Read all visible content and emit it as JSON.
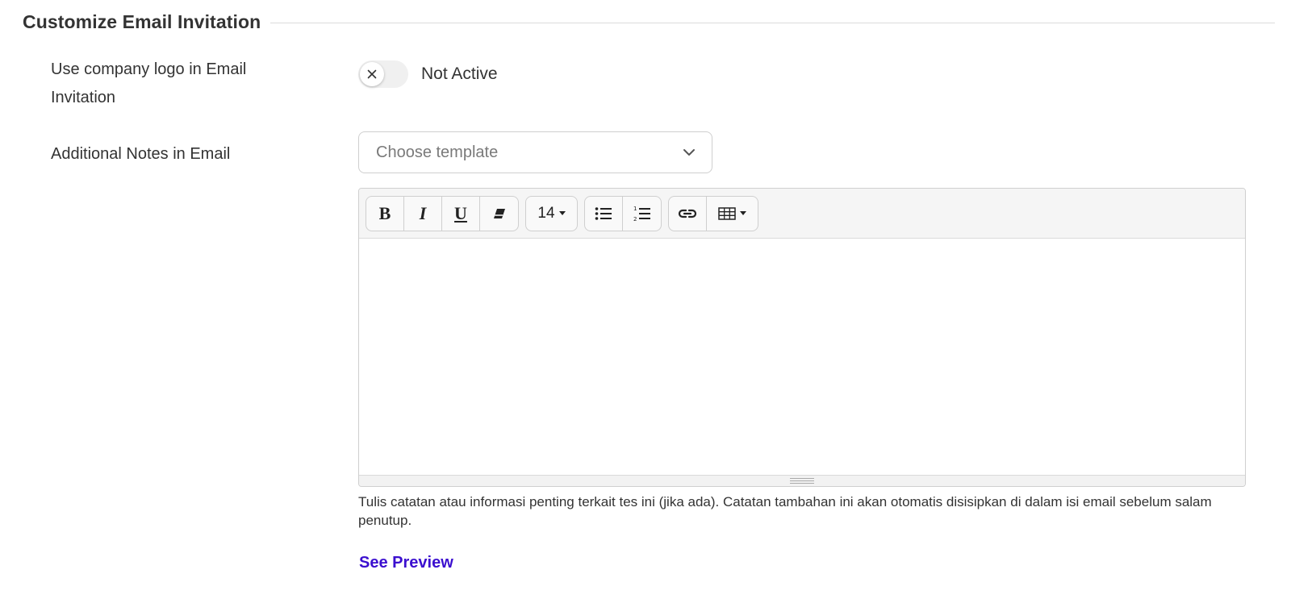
{
  "section": {
    "title": "Customize Email Invitation"
  },
  "logo_setting": {
    "label": "Use company logo in Email Invitation",
    "toggle_on": false,
    "status": "Not Active"
  },
  "notes_setting": {
    "label": "Additional Notes in Email",
    "template_select": {
      "placeholder": "Choose template"
    },
    "editor": {
      "toolbar": {
        "bold_label": "B",
        "italic_label": "I",
        "underline_label": "U",
        "clear_format_icon": "eraser-icon",
        "font_size": "14",
        "unordered_list_icon": "bullet-list-icon",
        "ordered_list_icon": "numbered-list-icon",
        "link_icon": "link-icon",
        "table_icon": "table-icon"
      },
      "content": ""
    },
    "help_text": "Tulis catatan atau informasi penting terkait tes ini (jika ada). Catatan tambahan ini akan otomatis disisipkan di dalam isi email sebelum salam penutup."
  },
  "preview_link": {
    "label": "See Preview"
  },
  "colors": {
    "link": "#3b0fcf",
    "text": "#333333",
    "muted": "#7a7a7a",
    "border": "#cfcfcf"
  }
}
